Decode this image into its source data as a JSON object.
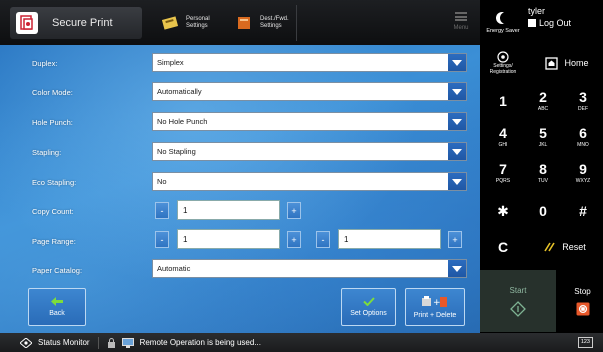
{
  "app": {
    "title": "Secure Print",
    "icon": "secure-print-icon"
  },
  "topbar": {
    "personal_settings": {
      "line1": "Personal",
      "line2": "Settings"
    },
    "dest_fwd_settings": {
      "line1": "Dest./Fwd.",
      "line2": "Settings"
    },
    "menu_label": "Menu"
  },
  "user": {
    "energy_saver": "Energy Saver",
    "name": "tyler",
    "logout": "Log Out"
  },
  "settings": [
    {
      "label": "Duplex:",
      "value": "Simplex"
    },
    {
      "label": "Color Mode:",
      "value": "Automatically"
    },
    {
      "label": "Hole Punch:",
      "value": "No Hole Punch"
    },
    {
      "label": "Stapling:",
      "value": "No Stapling"
    },
    {
      "label": "Eco Stapling:",
      "value": "No"
    }
  ],
  "copy_count": {
    "label": "Copy Count:",
    "value": "1"
  },
  "page_range": {
    "label": "Page Range:",
    "from": "1",
    "to": "1"
  },
  "paper_catalog": {
    "label": "Paper Catalog:",
    "value": "Automatic"
  },
  "buttons": {
    "back": "Back",
    "set_options": "Set Options",
    "print_delete": "Print + Delete"
  },
  "keypad": {
    "settings_registration": {
      "line1": "Settings/",
      "line2": "Registration"
    },
    "home": "Home",
    "keys": [
      {
        "d": "1",
        "s": ""
      },
      {
        "d": "2",
        "s": "ABC"
      },
      {
        "d": "3",
        "s": "DEF"
      },
      {
        "d": "4",
        "s": "GHI"
      },
      {
        "d": "5",
        "s": "JKL"
      },
      {
        "d": "6",
        "s": "MNO"
      },
      {
        "d": "7",
        "s": "PQRS"
      },
      {
        "d": "8",
        "s": "TUV"
      },
      {
        "d": "9",
        "s": "WXYZ"
      },
      {
        "d": "✱",
        "s": ""
      },
      {
        "d": "0",
        "s": ""
      },
      {
        "d": "#",
        "s": ""
      }
    ],
    "clear": "C",
    "reset": "Reset",
    "start": "Start",
    "stop": "Stop"
  },
  "status": {
    "monitor": "Status Monitor",
    "message": "Remote Operation is being used...",
    "counter": "123"
  },
  "colors": {
    "accent": "#2f7ccb",
    "stop": "#e8582a",
    "start_green": "#27312c"
  }
}
